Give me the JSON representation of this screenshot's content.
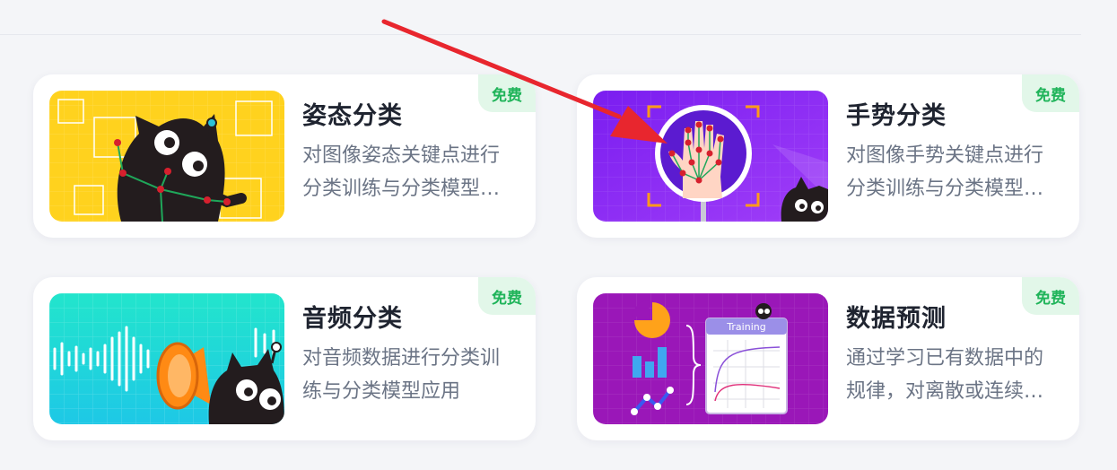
{
  "cards": [
    {
      "title": "姿态分类",
      "desc": "对图像姿态关键点进行分类训练与分类模型应用",
      "badge": "免费",
      "bg": "#ffd21e",
      "thumb_icon": "pose-cat-icon"
    },
    {
      "title": "手势分类",
      "desc": "对图像手势关键点进行分类训练与分类模型应用",
      "badge": "免费",
      "bg": "#8b2cf5",
      "thumb_icon": "hand-gesture-icon"
    },
    {
      "title": "音频分类",
      "desc": "对音频数据进行分类训练与分类模型应用",
      "badge": "免费",
      "bg": "#21d8d8",
      "thumb_icon": "megaphone-cat-icon"
    },
    {
      "title": "数据预测",
      "desc": "通过学习已有数据中的规律，对离散或连续数据进行预测",
      "badge": "免费",
      "bg": "#9a17b8",
      "thumb_icon": "data-chart-icon",
      "thumb_label": "Training"
    }
  ],
  "colors": {
    "badge_text": "#20b45a",
    "badge_bg": "#e2f7e9",
    "arrow": "#e8262e"
  }
}
